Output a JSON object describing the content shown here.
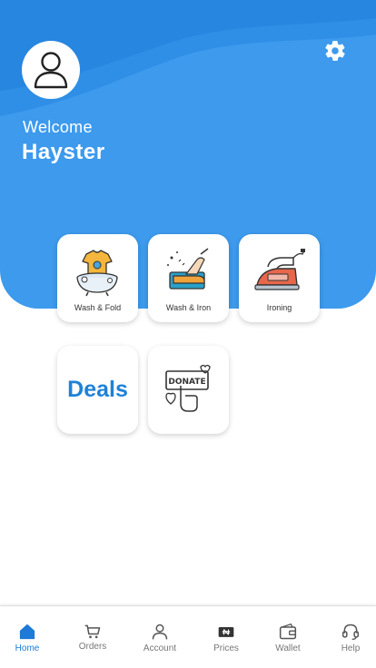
{
  "header": {
    "welcome_text": "Welcome",
    "user_name": "Hayster",
    "icons": {
      "avatar": "user-icon",
      "settings": "gear-icon"
    }
  },
  "services": [
    {
      "label": "Wash & Fold",
      "icon": "wash-fold-icon"
    },
    {
      "label": "Wash & Iron",
      "icon": "wash-iron-icon"
    },
    {
      "label": "Ironing",
      "icon": "iron-icon"
    }
  ],
  "extras": {
    "deals_label": "Deals",
    "donate_sign_text": "DONATE"
  },
  "nav": {
    "items": [
      {
        "label": "Home",
        "icon": "home-icon",
        "active": true
      },
      {
        "label": "Orders",
        "icon": "cart-icon"
      },
      {
        "label": "Account",
        "icon": "person-icon"
      },
      {
        "label": "Prices",
        "icon": "price-tag-icon"
      },
      {
        "label": "Wallet",
        "icon": "wallet-icon"
      },
      {
        "label": "Help",
        "icon": "headset-icon"
      }
    ]
  },
  "colors": {
    "primary": "#3d9aed",
    "accent": "#1e82d8",
    "active_nav": "#1e7ad6"
  }
}
